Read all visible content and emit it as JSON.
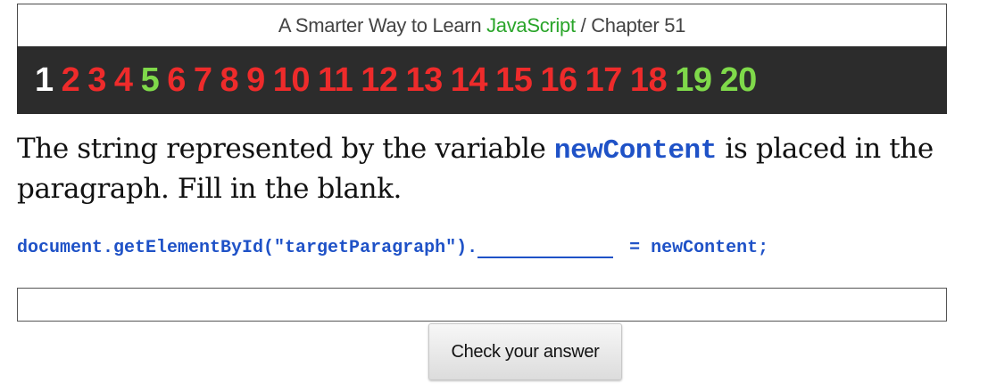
{
  "header": {
    "prefix": "A Smarter Way to Learn ",
    "brand": "JavaScript",
    "suffix": " / Chapter 51"
  },
  "colors": {
    "current": "#ffffff",
    "incorrect": "#ee2b2b",
    "correct": "#7fd94a",
    "brand": "#2aa52a",
    "code": "#1f52c7"
  },
  "exercises": [
    {
      "label": "1",
      "status": "current"
    },
    {
      "label": "2",
      "status": "incorrect"
    },
    {
      "label": "3",
      "status": "incorrect"
    },
    {
      "label": "4",
      "status": "incorrect"
    },
    {
      "label": "5",
      "status": "correct"
    },
    {
      "label": "6",
      "status": "incorrect"
    },
    {
      "label": "7",
      "status": "incorrect"
    },
    {
      "label": "8",
      "status": "incorrect"
    },
    {
      "label": "9",
      "status": "incorrect"
    },
    {
      "label": "10",
      "status": "incorrect"
    },
    {
      "label": "11",
      "status": "incorrect"
    },
    {
      "label": "12",
      "status": "incorrect"
    },
    {
      "label": "13",
      "status": "incorrect"
    },
    {
      "label": "14",
      "status": "incorrect"
    },
    {
      "label": "15",
      "status": "incorrect"
    },
    {
      "label": "16",
      "status": "incorrect"
    },
    {
      "label": "17",
      "status": "incorrect"
    },
    {
      "label": "18",
      "status": "incorrect"
    },
    {
      "label": "19",
      "status": "correct"
    },
    {
      "label": "20",
      "status": "correct"
    }
  ],
  "question": {
    "before": "The string represented by the variable ",
    "code": "newContent",
    "after": " is placed in the paragraph. Fill in the blank."
  },
  "code_line": {
    "before": "document.getElementById(\"targetParagraph\").",
    "after": " = newContent;"
  },
  "answer": {
    "value": "",
    "placeholder": ""
  },
  "check_button": {
    "label": "Check your answer"
  }
}
